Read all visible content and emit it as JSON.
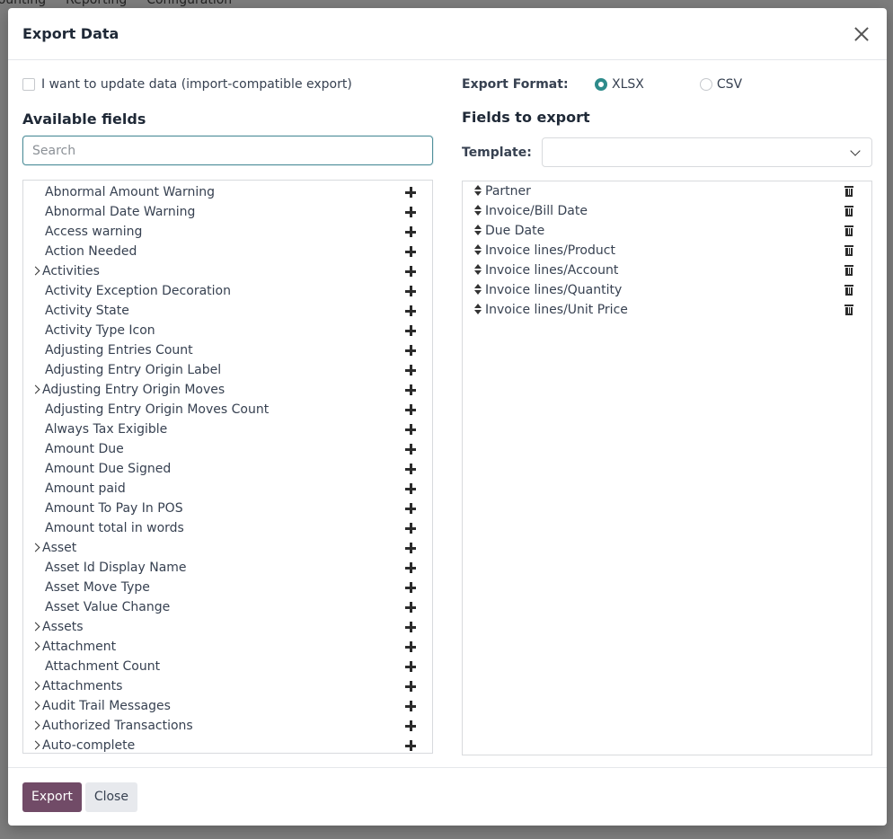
{
  "background": {
    "menu": [
      "counting",
      "Reporting",
      "Configuration"
    ]
  },
  "modal": {
    "title": "Export Data"
  },
  "left": {
    "import_compatible_label": "I want to update data (import-compatible export)",
    "available_fields_title": "Available fields",
    "search_placeholder": "Search",
    "fields": [
      {
        "label": "Abnormal Amount Warning",
        "expandable": false
      },
      {
        "label": "Abnormal Date Warning",
        "expandable": false
      },
      {
        "label": "Access warning",
        "expandable": false
      },
      {
        "label": "Action Needed",
        "expandable": false
      },
      {
        "label": "Activities",
        "expandable": true
      },
      {
        "label": "Activity Exception Decoration",
        "expandable": false
      },
      {
        "label": "Activity State",
        "expandable": false
      },
      {
        "label": "Activity Type Icon",
        "expandable": false
      },
      {
        "label": "Adjusting Entries Count",
        "expandable": false
      },
      {
        "label": "Adjusting Entry Origin Label",
        "expandable": false
      },
      {
        "label": "Adjusting Entry Origin Moves",
        "expandable": true
      },
      {
        "label": "Adjusting Entry Origin Moves Count",
        "expandable": false
      },
      {
        "label": "Always Tax Exigible",
        "expandable": false
      },
      {
        "label": "Amount Due",
        "expandable": false
      },
      {
        "label": "Amount Due Signed",
        "expandable": false
      },
      {
        "label": "Amount paid",
        "expandable": false
      },
      {
        "label": "Amount To Pay In POS",
        "expandable": false
      },
      {
        "label": "Amount total in words",
        "expandable": false
      },
      {
        "label": "Asset",
        "expandable": true
      },
      {
        "label": "Asset Id Display Name",
        "expandable": false
      },
      {
        "label": "Asset Move Type",
        "expandable": false
      },
      {
        "label": "Asset Value Change",
        "expandable": false
      },
      {
        "label": "Assets",
        "expandable": true
      },
      {
        "label": "Attachment",
        "expandable": true
      },
      {
        "label": "Attachment Count",
        "expandable": false
      },
      {
        "label": "Attachments",
        "expandable": true
      },
      {
        "label": "Audit Trail Messages",
        "expandable": true
      },
      {
        "label": "Authorized Transactions",
        "expandable": true
      },
      {
        "label": "Auto-complete",
        "expandable": true
      }
    ]
  },
  "right": {
    "export_format_label": "Export Format:",
    "formats": [
      {
        "label": "XLSX",
        "checked": true
      },
      {
        "label": "CSV",
        "checked": false
      }
    ],
    "fields_to_export_title": "Fields to export",
    "template_label": "Template:",
    "template_value": "",
    "export_fields": [
      "Partner",
      "Invoice/Bill Date",
      "Due Date",
      "Invoice lines/Product",
      "Invoice lines/Account",
      "Invoice lines/Quantity",
      "Invoice lines/Unit Price"
    ]
  },
  "footer": {
    "export_label": "Export",
    "close_label": "Close"
  }
}
